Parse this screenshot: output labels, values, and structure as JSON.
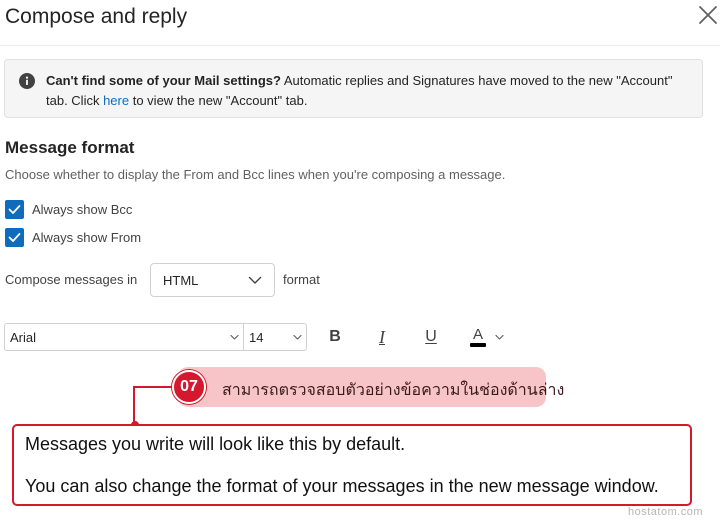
{
  "dialog": {
    "title": "Compose and reply",
    "close_icon": "close-icon"
  },
  "info_bar": {
    "icon": "info-icon",
    "bold_text": "Can't find some of your Mail settings?",
    "text_before_link": " Automatic replies and Signatures have moved to the new \"Account\" tab. Click ",
    "link_text": "here",
    "text_after_link": " to view the new \"Account\" tab."
  },
  "message_format": {
    "title": "Message format",
    "description": "Choose whether to display the From and Bcc lines when you're composing a message.",
    "options": [
      {
        "label": "Always show Bcc",
        "checked": true
      },
      {
        "label": "Always show From",
        "checked": true
      }
    ],
    "compose_label": "Compose messages in",
    "compose_value": "HTML",
    "compose_suffix": "format"
  },
  "toolbar": {
    "font_name": "Arial",
    "font_size": "14",
    "bold_label": "B",
    "italic_label": "I",
    "underline_label": "U",
    "font_color_label": "A"
  },
  "annotation": {
    "step_number": "07",
    "text": "สามารถตรวจสอบตัวอย่างข้อความในช่องด้านล่าง"
  },
  "preview": {
    "line1": "Messages you write will look like this by default.",
    "line2": "You can also change the format of your messages in the new message window."
  },
  "watermark": "hostatom.com",
  "colors": {
    "accent": "#0f6cbd",
    "annotation_red": "#d4182d",
    "annotation_pink": "#f7c5c7"
  }
}
